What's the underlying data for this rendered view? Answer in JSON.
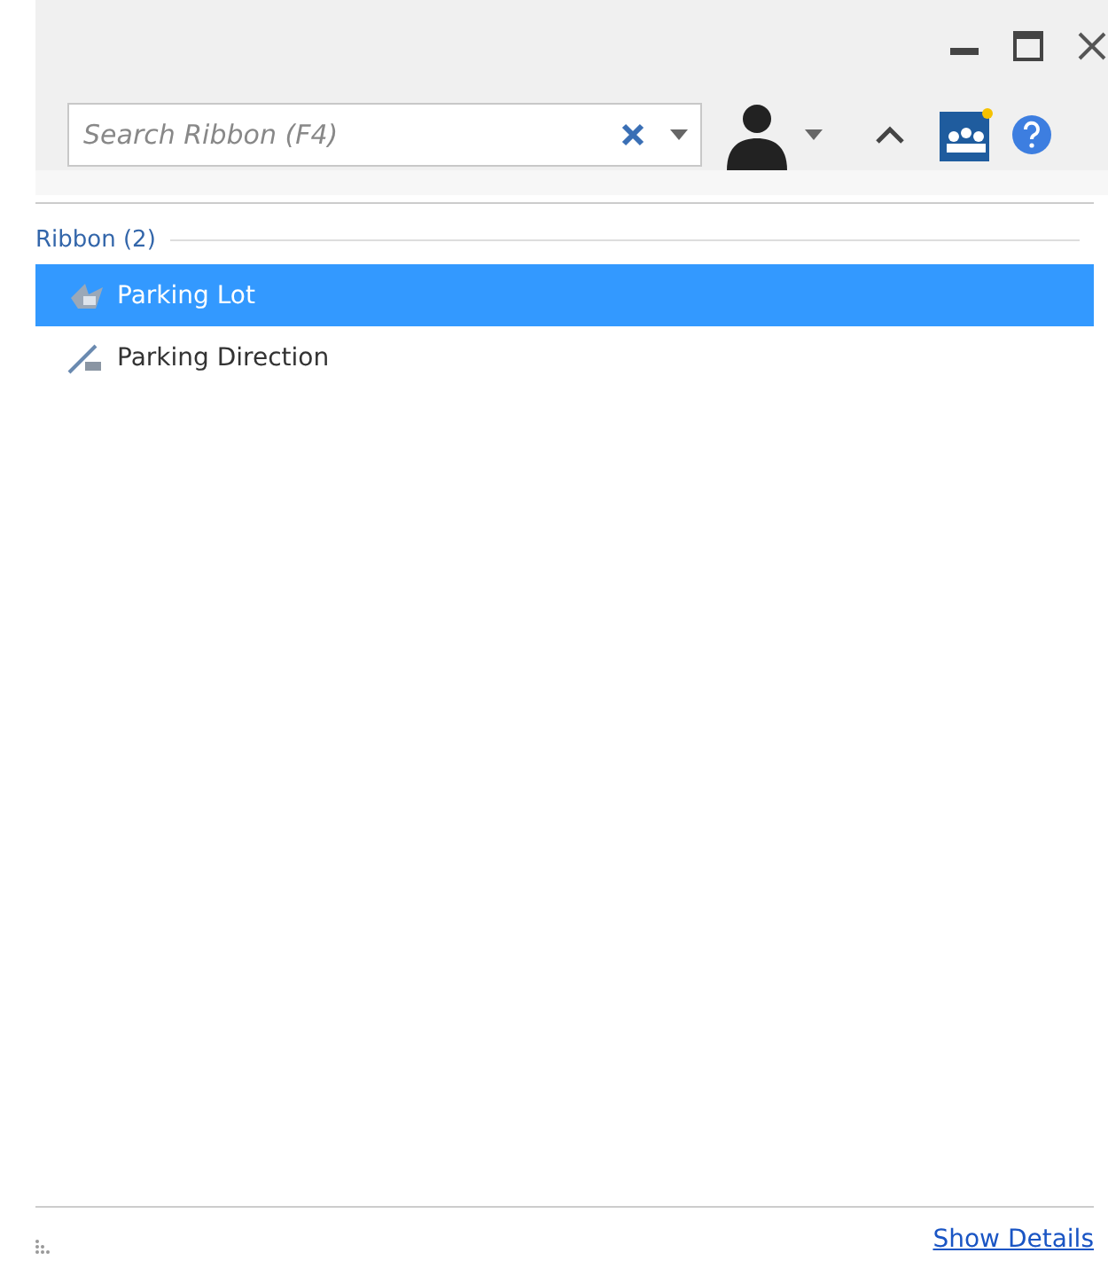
{
  "search": {
    "placeholder": "Search Ribbon (F4)"
  },
  "results": {
    "group": "Ribbon (2)",
    "items": [
      {
        "label": "Parking Lot",
        "kind": "lot",
        "selected": true
      },
      {
        "label": "Parking Direction",
        "kind": "direction",
        "selected": false
      }
    ]
  },
  "footer": {
    "link": "Show Details"
  }
}
